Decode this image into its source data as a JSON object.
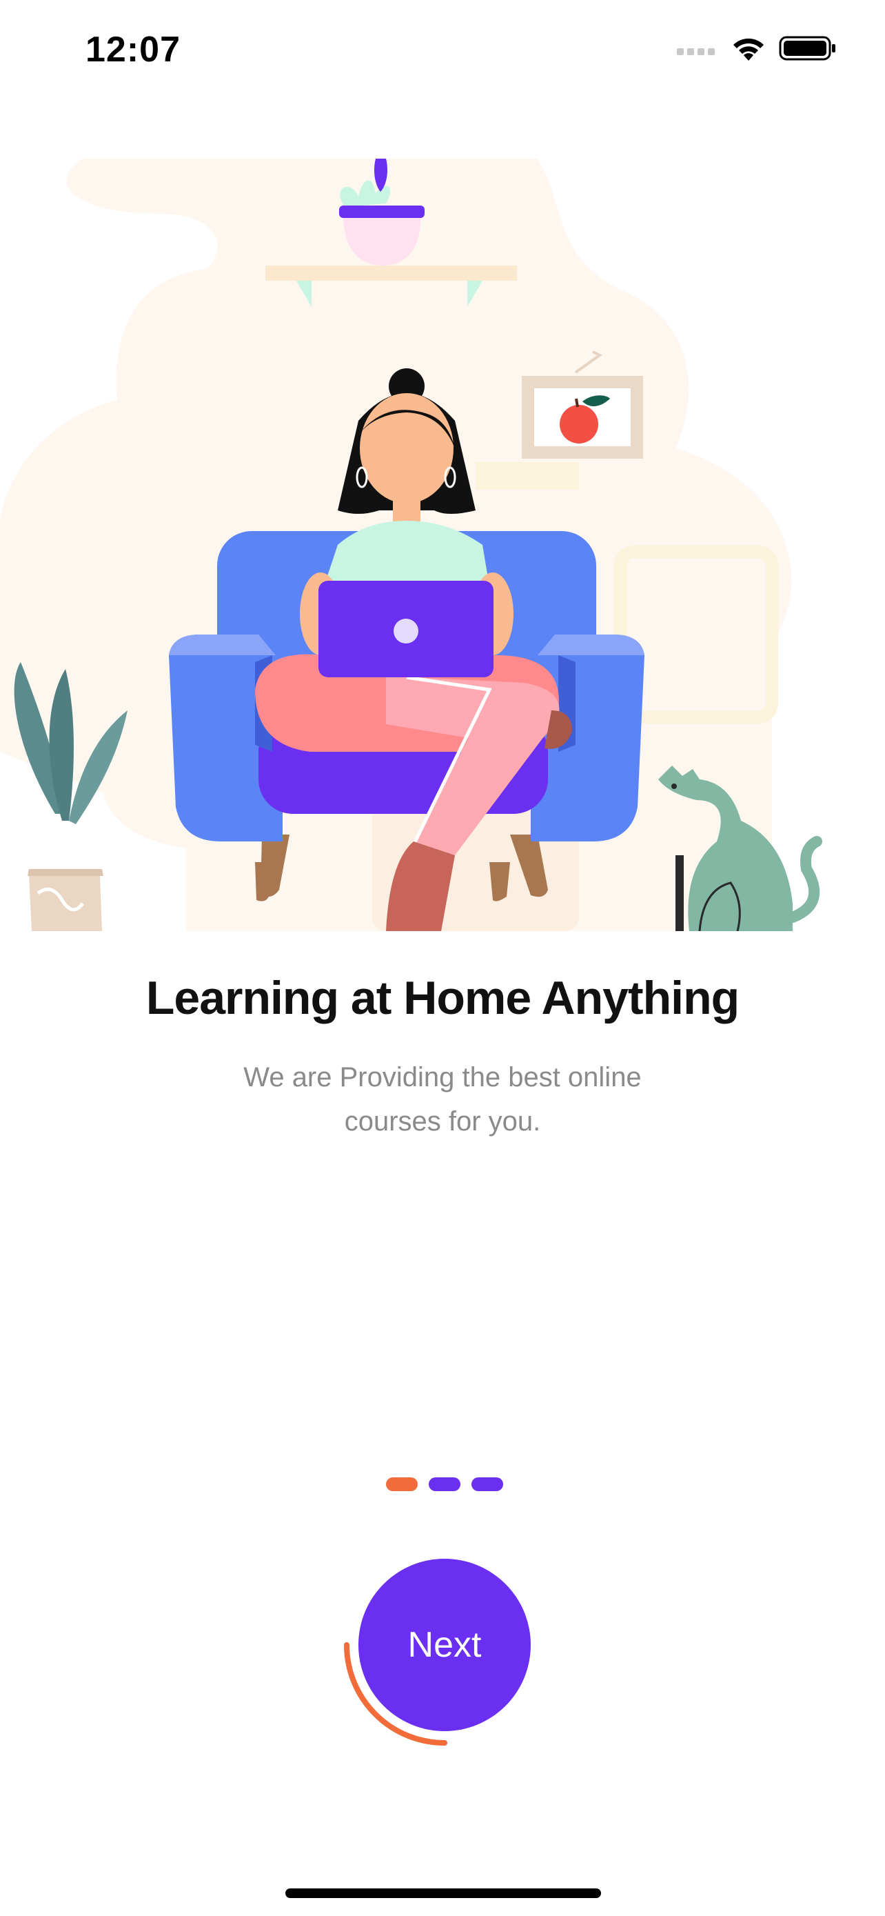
{
  "status_bar": {
    "time": "12:07",
    "icons": [
      "cellular-signal-icon",
      "wifi-icon",
      "battery-icon"
    ]
  },
  "onboarding": {
    "title": "Learning at Home Anything",
    "subtitle": "We are Providing the best online courses for you.",
    "page_indicator": {
      "total": 3,
      "active_index": 0,
      "active_color": "#F26B3A",
      "inactive_color": "#6A2FF0"
    },
    "next_button": {
      "label": "Next",
      "color": "#6A2FF0",
      "progress_color": "#F26B3A",
      "progress": 0.25
    }
  },
  "colors": {
    "primary": "#6A2FF0",
    "accent": "#F26B3A",
    "sofa": "#5B84F7",
    "background_blob": "#FDF7F0"
  }
}
